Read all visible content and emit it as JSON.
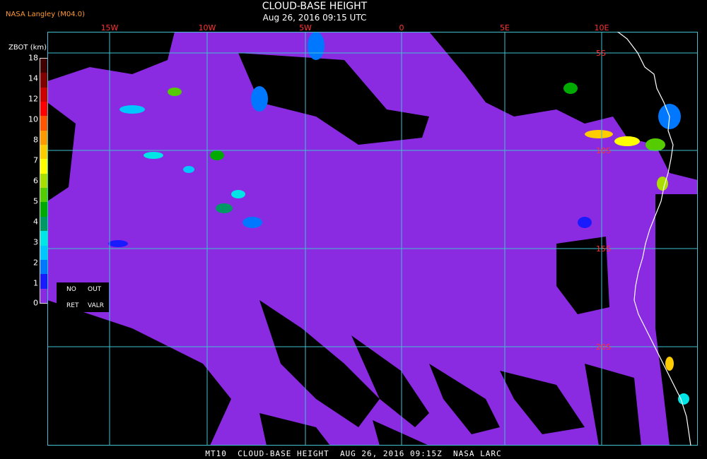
{
  "credit": "NASA Langley (M04.0)",
  "title": "CLOUD-BASE HEIGHT",
  "subtitle": "Aug 26, 2016 09:15 UTC",
  "footer": "MT10  CLOUD-BASE HEIGHT  AUG 26, 2016 09:15Z  NASA LARC",
  "colorbar": {
    "unit_label": "ZBOT (km)",
    "ticks": [
      "18",
      "14",
      "12",
      "10",
      "8",
      "7",
      "6",
      "5",
      "4",
      "3",
      "2",
      "1",
      "0"
    ],
    "colors": [
      "#8a2be2",
      "#1a1aff",
      "#0077ff",
      "#00c8ff",
      "#00e5e5",
      "#009966",
      "#00aa00",
      "#55cc00",
      "#aadd00",
      "#ffff00",
      "#ffcc00",
      "#ff9900",
      "#ff5500",
      "#ff0000",
      "#cc0000",
      "#800000",
      "#400000"
    ]
  },
  "legend_box": {
    "no": "NO",
    "ret": "RET",
    "out": "OUT",
    "valr": "VALR"
  },
  "longitude_labels": [
    "15W",
    "10W",
    "5W",
    "0",
    "5E",
    "10E"
  ],
  "latitude_labels": [
    "5S",
    "10S",
    "15S",
    "20S"
  ],
  "map_colors": {
    "ocean_cloud": "#8a2be2",
    "clear": "#000000",
    "grid": "#40c0d0",
    "coast": "#ffffff",
    "label": "#ff3333"
  }
}
